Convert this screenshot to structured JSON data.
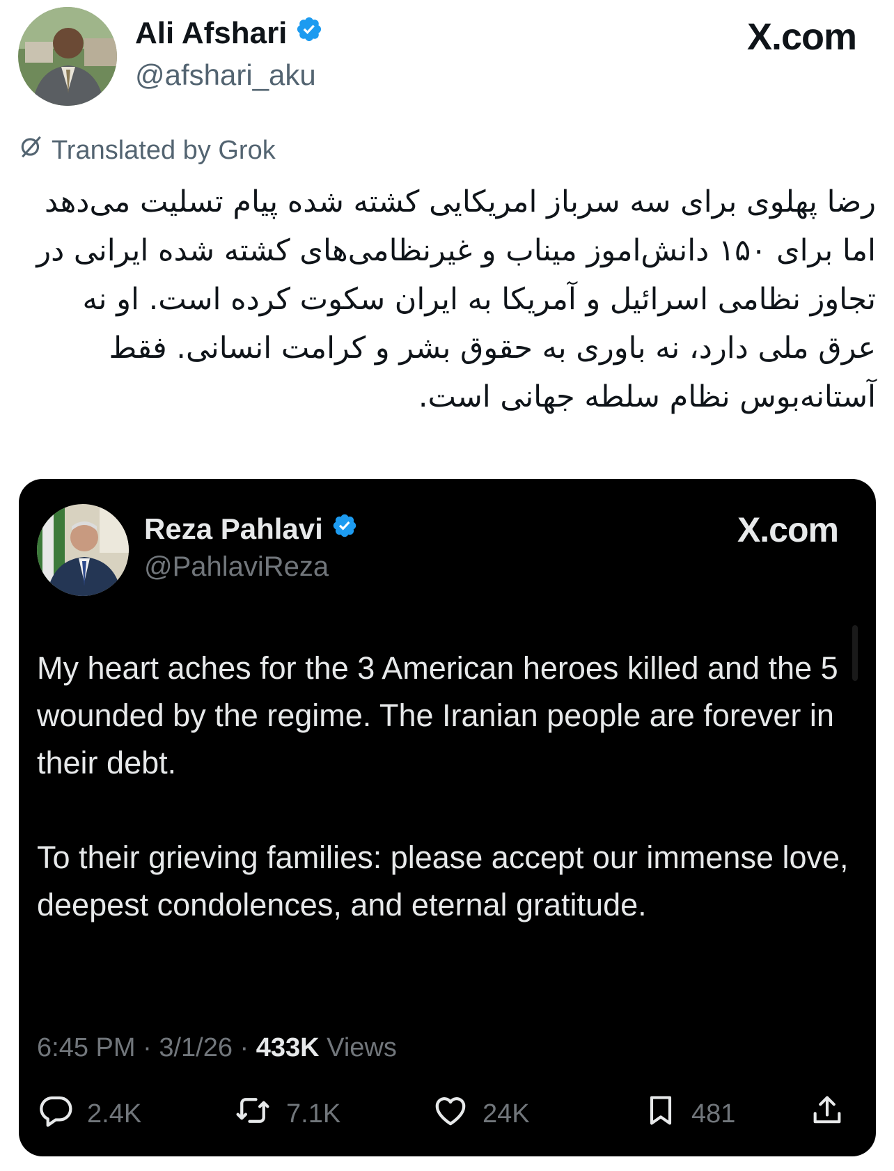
{
  "outer_tweet": {
    "author_name": "Ali Afshari",
    "handle": "@afshari_aku",
    "site": "X.com",
    "translated_label": "Translated by Grok",
    "text": "رضا پهلوی برای سه سرباز امریکایی کشته شده پیام تسلیت می‌دهد اما برای ۱۵۰ دانش‌اموز میناب و غیرنظامی‌های کشته شده ایرانی در تجاوز نظامی اسرائیل و آمریکا به ایران سکوت کرده است. او نه عرق ملی دارد، نه باوری به حقوق بشر و کرامت انسانی. فقط آستانه‌بوس نظام سلطه جهانی است."
  },
  "quoted_tweet": {
    "author_name": "Reza Pahlavi",
    "handle": "@PahlaviReza",
    "site": "X.com",
    "paragraphs": [
      "My heart aches for the 3 American heroes killed and the 5 wounded by the regime. The Iranian people are forever in their debt.",
      "To their grieving families: please accept our immense love, deepest condolences, and eternal gratitude."
    ],
    "time": "6:45 PM",
    "date": "3/1/26",
    "views_count": "433K",
    "views_label": "Views",
    "separator": "·",
    "stats": {
      "replies": "2.4K",
      "reposts": "7.1K",
      "likes": "24K",
      "bookmarks": "481"
    }
  },
  "colors": {
    "verified_blue": "#1d9bf0",
    "secondary_text": "#536471",
    "card_background": "#000000",
    "card_text": "#e7e9ea",
    "card_secondary": "#71767b"
  },
  "icons": [
    "verified-badge-icon",
    "grok-translate-icon",
    "reply-icon",
    "retweet-icon",
    "like-icon",
    "bookmark-icon",
    "share-icon"
  ]
}
